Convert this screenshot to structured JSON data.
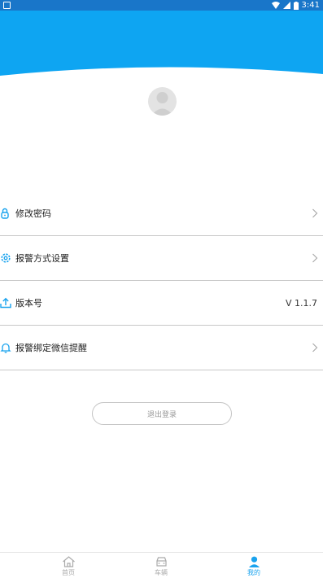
{
  "status_bar": {
    "time": "3:41"
  },
  "menu": {
    "items": [
      {
        "label": "修改密码",
        "icon": "lock-icon",
        "trailing": "chevron"
      },
      {
        "label": "报警方式设置",
        "icon": "gear-icon",
        "trailing": "chevron"
      },
      {
        "label": "版本号",
        "icon": "upload-icon",
        "trailing": "value",
        "value": "V 1.1.7"
      },
      {
        "label": "报警绑定微信提醒",
        "icon": "bell-icon",
        "trailing": "chevron"
      }
    ]
  },
  "logout_label": "退出登录",
  "tabs": [
    {
      "label": "首页",
      "icon": "home-icon",
      "active": false
    },
    {
      "label": "车辆",
      "icon": "car-icon",
      "active": false
    },
    {
      "label": "我的",
      "icon": "person-icon",
      "active": true
    }
  ],
  "colors": {
    "accent": "#1aa3ee",
    "header": "#0ea5f2",
    "status_bar": "#1976c9"
  }
}
